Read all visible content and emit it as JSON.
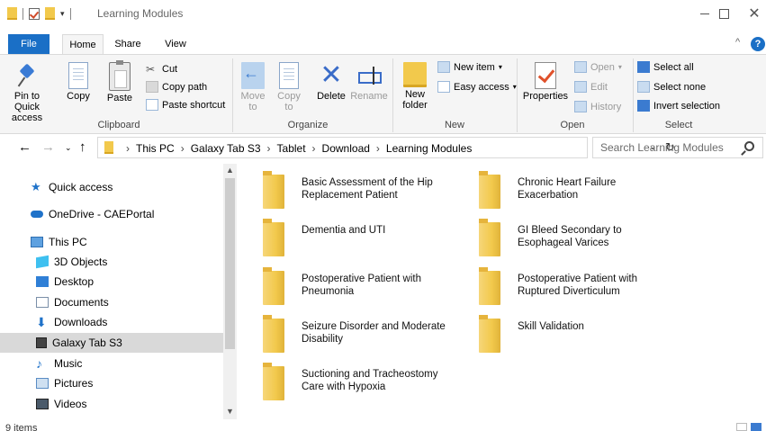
{
  "window": {
    "title": "Learning Modules",
    "controls": {
      "minimize": "—",
      "maximize": "☐",
      "close": "✕"
    }
  },
  "ribbon_tabs": [
    "File",
    "Home",
    "Share",
    "View"
  ],
  "ribbon_help": "?",
  "ribbon_collapse": "^",
  "ribbon": {
    "clipboard": {
      "label": "Clipboard",
      "pin": "Pin to Quick access",
      "copy": "Copy",
      "paste": "Paste",
      "cut": "Cut",
      "copy_path": "Copy path",
      "paste_shortcut": "Paste shortcut"
    },
    "organize": {
      "label": "Organize",
      "move_to": "Move to",
      "copy_to": "Copy to",
      "delete": "Delete",
      "rename": "Rename"
    },
    "new": {
      "label": "New",
      "new_folder": "New folder",
      "new_item": "New item",
      "easy_access": "Easy access"
    },
    "open": {
      "label": "Open",
      "properties": "Properties",
      "open": "Open",
      "edit": "Edit",
      "history": "History"
    },
    "select": {
      "label": "Select",
      "select_all": "Select all",
      "select_none": "Select none",
      "invert_selection": "Invert selection"
    }
  },
  "address": {
    "crumbs": [
      "This PC",
      "Galaxy Tab S3",
      "Tablet",
      "Download",
      "Learning Modules"
    ],
    "search_placeholder": "Search Learning Modules"
  },
  "nav_pane": [
    {
      "label": "Quick access",
      "icon": "star-icon"
    },
    {
      "label": "OneDrive - CAEPortal",
      "icon": "cloud-icon"
    },
    {
      "label": "This PC",
      "icon": "computer-icon"
    },
    {
      "label": "3D Objects",
      "icon": "cube-icon"
    },
    {
      "label": "Desktop",
      "icon": "desktop-icon"
    },
    {
      "label": "Documents",
      "icon": "document-icon"
    },
    {
      "label": "Downloads",
      "icon": "download-icon"
    },
    {
      "label": "Galaxy Tab S3",
      "icon": "tablet-icon",
      "selected": true
    },
    {
      "label": "Music",
      "icon": "music-icon"
    },
    {
      "label": "Pictures",
      "icon": "pictures-icon"
    },
    {
      "label": "Videos",
      "icon": "videos-icon"
    }
  ],
  "folders": [
    "Basic Assessment of the Hip Replacement Patient",
    "Chronic Heart Failure Exacerbation",
    "Dementia and UTI",
    "GI Bleed Secondary to Esophageal Varices",
    "Postoperative Patient with Pneumonia",
    "Postoperative Patient with Ruptured Diverticulum",
    "Seizure Disorder and Moderate Disability",
    "Skill Validation",
    "Suctioning and Tracheostomy Care with Hypoxia"
  ],
  "status": {
    "item_count": "9 items"
  },
  "colors": {
    "accent": "#1a6fc6",
    "folder": "#f2c94c",
    "selected": "#d9d9d9"
  }
}
